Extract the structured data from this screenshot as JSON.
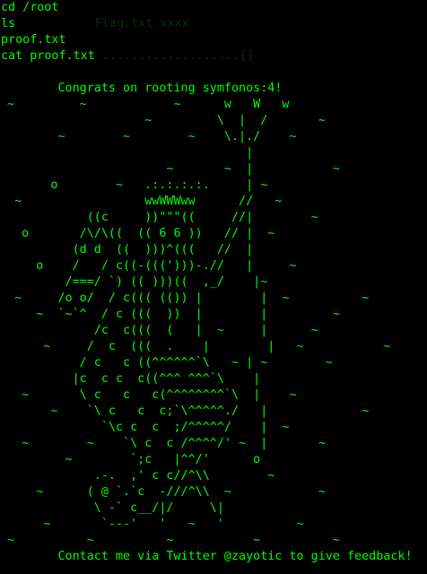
{
  "terminal": {
    "colors": {
      "background": "#000000",
      "text": "#00ff00",
      "faint_text": "#0b2a0b"
    },
    "commands": [
      {
        "text": "cd /root",
        "ghost": ""
      },
      {
        "text": "ls",
        "ghost": "           Flag.txt_xxxx"
      },
      {
        "text": "proof.txt",
        "ghost": ""
      },
      {
        "text": "cat proof.txt",
        "ghost": " ...................[]"
      }
    ],
    "banner_lines": [
      "",
      "        Congrats on rooting symfonos:4!",
      " ~         ~            ~      w   W   w",
      "                    ~         \\  |  /       ~",
      "        ~        ~        ~    \\.|./    ~",
      "                                  |",
      "                       ~       ~  |           ~",
      "       o        ~   .:.:.:.:.     | ~",
      "  ~                 wwWWWww      //   ~",
      "            ((c     ))\"\"\"((     //|        ~",
      "   o       /\\/\\((  (( 6 6 ))   // |  ~",
      "          (d d  ((  )))^(((   //  |",
      "     o    /   / c((-(((')))-.//   |     ~",
      "         /===/ `) (( )))((  ,_/    |~",
      "  ~     /o o/  / c((( (()) |        |  ~          ~",
      "     ~  `~`^  / c (((  ))  |        |         ~",
      "             /c  c(((  (   |  ~     |      ~",
      "      ~     /  c  (((  .    |        |   ~           ~",
      "           / c   c ((^^^^^^`\\   ~ | ~        ~",
      "          |c  c c  c((^^^ ^^^`\\    |",
      "   ~       \\ c   c   c(^^^^^^^^`\\  |    ~",
      "       ~    `\\ c   c  c;`\\^^^^^./   |             ~",
      "              `\\c c  c  ;/^^^^^/    |  ~",
      "   ~        ~    `\\ c  c /^^^^/' ~  |       ~",
      "         ~        `;c   |^^/'      o",
      "             .-.  ,' c c//^\\\\        ~",
      "     ~      ( @ `.`c  -///^\\\\  ~            ~",
      "             \\ -` c__/|/     \\|",
      "      ~       `---'   '   ~   '          ~",
      " ~          ~          ~           ~          ~",
      "        Contact me via Twitter @zayotic to give feedback!"
    ]
  }
}
